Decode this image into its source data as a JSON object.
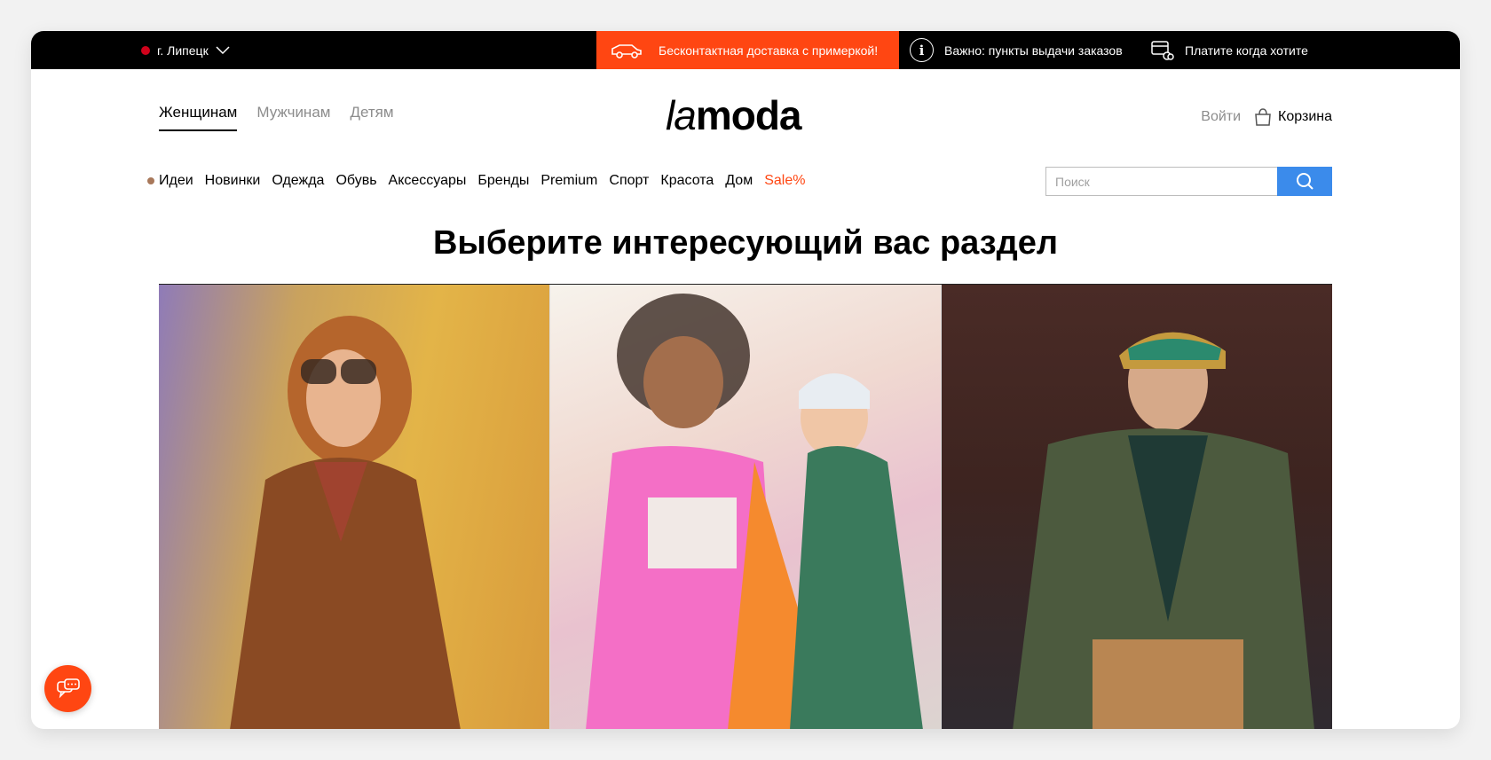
{
  "topbar": {
    "city": "г. Липецк",
    "promo": "Бесконтактная доставка с примеркой!",
    "notice": "Важно: пункты выдачи заказов",
    "pay": "Платите когда хотите"
  },
  "header": {
    "gender_tabs": [
      {
        "label": "Женщинам",
        "active": true
      },
      {
        "label": "Мужчинам",
        "active": false
      },
      {
        "label": "Детям",
        "active": false
      }
    ],
    "logo": {
      "part1": "la",
      "part2": "moda"
    },
    "login": "Войти",
    "cart": "Корзина"
  },
  "nav": {
    "items": [
      "Идеи",
      "Новинки",
      "Одежда",
      "Обувь",
      "Аксессуары",
      "Бренды",
      "Premium",
      "Спорт",
      "Красота",
      "Дом"
    ],
    "sale": "Sale%"
  },
  "search": {
    "placeholder": "Поиск"
  },
  "main": {
    "heading": "Выберите интересующий вас раздел",
    "cards": [
      "women",
      "kids",
      "men"
    ]
  },
  "colors": {
    "accent": "#ff4612",
    "search_button": "#3b8beb",
    "topbar": "#000000"
  },
  "icons": [
    "chevron-down-icon",
    "delivery-car-icon",
    "info-icon",
    "wallet-icon",
    "cart-bag-icon",
    "search-icon",
    "chat-icon"
  ]
}
